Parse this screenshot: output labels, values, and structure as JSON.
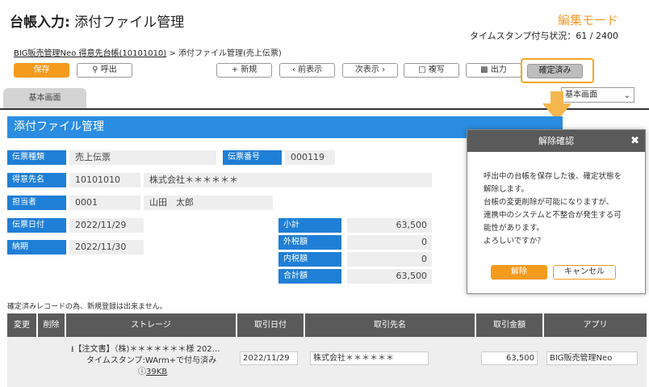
{
  "header": {
    "title_bold": "台帳入力:",
    "title_rest": "添付ファイル管理",
    "mode": "編集モード",
    "stamp": "タイムスタンプ付与状況：61 / 2400"
  },
  "breadcrumb": {
    "root": "BIG販売管理Neo 得意先台帳(10101010)",
    "sep": " > ",
    "current": "添付ファイル管理(売上伝票)"
  },
  "toolbar": {
    "save": "保存",
    "call": "呼出",
    "new": "新規",
    "prev": "前表示",
    "next": "次表示",
    "copy": "複写",
    "print": "出力",
    "confirmed": "確定済み"
  },
  "tab": {
    "basic": "基本画面",
    "select": "基本画面"
  },
  "section": {
    "title": "添付ファイル管理"
  },
  "form": {
    "slip_type_label": "伝票種類",
    "slip_type": "売上伝票",
    "slip_no_label": "伝票番号",
    "slip_no": "000119",
    "customer_label": "得意先名",
    "customer_code": "10101010",
    "customer_name": "株式会社＊＊＊＊＊＊",
    "staff_label": "担当者",
    "staff_code": "0001",
    "staff_name": "山田　太郎",
    "date_label": "伝票日付",
    "date": "2022/11/29",
    "due_label": "納期",
    "due": "2022/11/30",
    "subtotal_label": "小計",
    "subtotal": "63,500",
    "outtax_label": "外税額",
    "outtax": "0",
    "intax_label": "内税額",
    "intax": "0",
    "total_label": "合計額",
    "total": "63,500"
  },
  "notice": "確定済みレコードの為、新規登録は出来ません。",
  "table": {
    "columns": [
      "変更",
      "削除",
      "ストレージ",
      "取引日付",
      "取引先名",
      "取引金額",
      "アプリ"
    ],
    "row": {
      "file": "【注文書】（株)＊＊＊＊＊＊＊様 202…",
      "stamp": "タイムスタンプ:WArm+で付与済み",
      "size": "39KB",
      "date": "2022/11/29",
      "partner": "株式会社＊＊＊＊＊＊",
      "amount": "63,500",
      "app": "BIG販売管理Neo"
    }
  },
  "dialog": {
    "title": "解除確認",
    "lines": [
      "呼出中の台帳を保存した後、確定状態を",
      "解除します。",
      "台帳の変更削除が可能になりますが、",
      "連携中のシステムと不整合が発生する可",
      "能性があります。",
      "よろしいですか？"
    ],
    "ok": "解除",
    "cancel": "キャンセル"
  },
  "colors": {
    "accent": "#f49b1e",
    "blue": "#1f7fd6",
    "header_blue": "#2a8de1"
  }
}
